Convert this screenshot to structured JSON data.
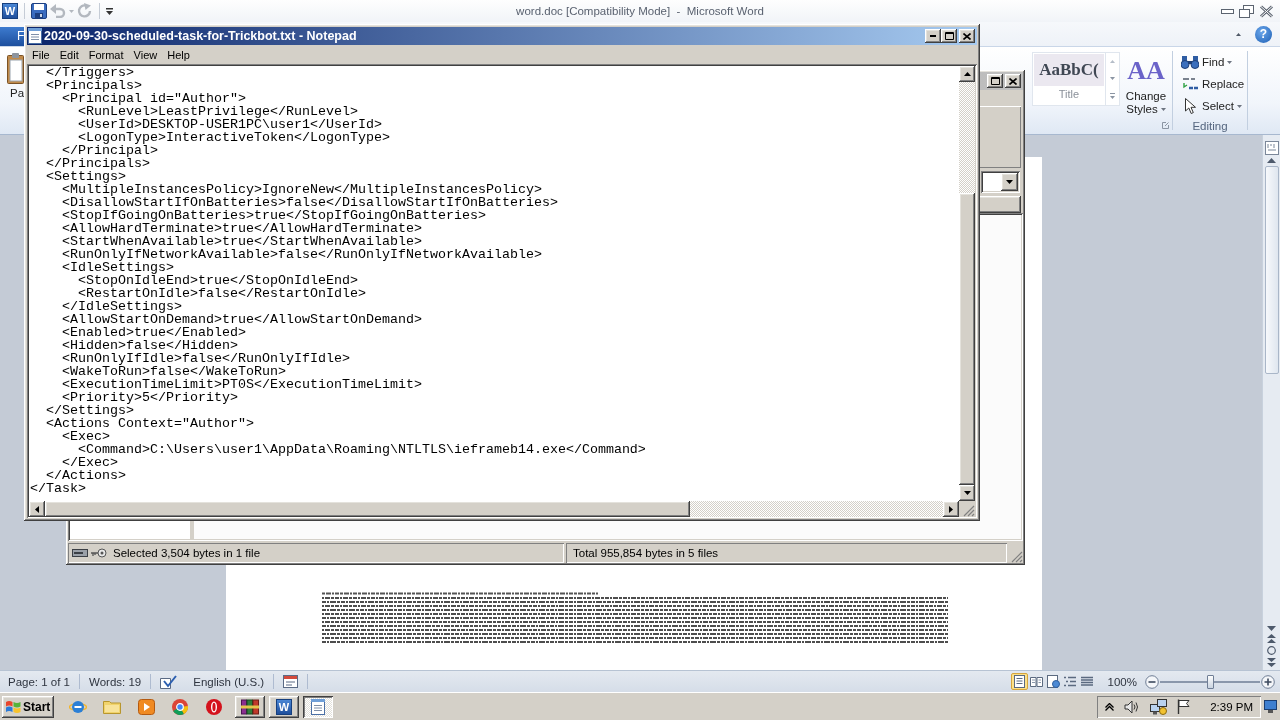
{
  "word_window": {
    "app_icon": "W",
    "quick_access": [
      {
        "kind": "save",
        "disabled": false
      },
      {
        "kind": "undo",
        "disabled": true
      },
      {
        "kind": "redo",
        "disabled": true
      }
    ],
    "title": "word.doc [Compatibility Mode]  -  Microsoft Word",
    "file_tab": "F",
    "help": "?",
    "ribbon": {
      "paste_label": "Pa",
      "style_preview": "AaBbC(",
      "style_name": "Title",
      "change_styles_icon": "AA",
      "change_styles": "Change Styles",
      "editing_items": [
        {
          "kind": "find",
          "label": "Find",
          "dropdown": true
        },
        {
          "kind": "replace",
          "label": "Replace",
          "dropdown": false
        },
        {
          "kind": "select",
          "label": "Select",
          "dropdown": true
        }
      ],
      "editing_label": "Editing"
    },
    "status_bar": {
      "page": "Page: 1 of 1",
      "words": "Words: 19",
      "language": "English (U.S.)",
      "views": [
        {
          "kind": "print-layout",
          "selected": true
        },
        {
          "kind": "full-screen-reading",
          "selected": false
        },
        {
          "kind": "web-layout",
          "selected": false
        },
        {
          "kind": "outline",
          "selected": false
        },
        {
          "kind": "draft",
          "selected": false
        }
      ],
      "zoom": "100%",
      "zoom_slider": {
        "level": 0.5
      }
    }
  },
  "explorer_window": {
    "status_bar": {
      "selection": "Selected 3,504 bytes in 1 file",
      "total": "Total 955,854 bytes in 5 files"
    }
  },
  "notepad": {
    "title": "2020-09-30-scheduled-task-for-Trickbot.txt - Notepad",
    "menu": [
      "File",
      "Edit",
      "Format",
      "View",
      "Help"
    ],
    "lines": [
      {
        "children": [
          {
            "text": "</Triggers>"
          },
          {
            "text": "<Principals>"
          },
          {
            "children": [
              {
                "text": "<Principal id=\"Author\">"
              },
              {
                "children": [
                  {
                    "text": "<RunLevel>LeastPrivilege</RunLevel>"
                  },
                  {
                    "text": "<UserId>DESKTOP-USER1PC\\user1</UserId>"
                  },
                  {
                    "text": "<LogonType>InteractiveToken</LogonType>"
                  }
                ]
              },
              {
                "text": "</Principal>"
              }
            ]
          },
          {
            "text": "</Principals>"
          },
          {
            "text": "<Settings>"
          },
          {
            "children": [
              {
                "text": "<MultipleInstancesPolicy>IgnoreNew</MultipleInstancesPolicy>"
              },
              {
                "text": "<DisallowStartIfOnBatteries>false</DisallowStartIfOnBatteries>"
              },
              {
                "text": "<StopIfGoingOnBatteries>true</StopIfGoingOnBatteries>"
              },
              {
                "text": "<AllowHardTerminate>true</AllowHardTerminate>"
              },
              {
                "text": "<StartWhenAvailable>true</StartWhenAvailable>"
              },
              {
                "text": "<RunOnlyIfNetworkAvailable>false</RunOnlyIfNetworkAvailable>"
              },
              {
                "text": "<IdleSettings>"
              },
              {
                "children": [
                  {
                    "text": "<StopOnIdleEnd>true</StopOnIdleEnd>"
                  },
                  {
                    "text": "<RestartOnIdle>false</RestartOnIdle>"
                  }
                ]
              },
              {
                "text": "</IdleSettings>"
              },
              {
                "text": "<AllowStartOnDemand>true</AllowStartOnDemand>"
              },
              {
                "text": "<Enabled>true</Enabled>"
              },
              {
                "text": "<Hidden>false</Hidden>"
              },
              {
                "text": "<RunOnlyIfIdle>false</RunOnlyIfIdle>"
              },
              {
                "text": "<WakeToRun>false</WakeToRun>"
              },
              {
                "text": "<ExecutionTimeLimit>PT0S</ExecutionTimeLimit>"
              },
              {
                "text": "<Priority>5</Priority>"
              }
            ]
          },
          {
            "text": "</Settings>"
          },
          {
            "text": "<Actions Context=\"Author\">"
          },
          {
            "children": [
              {
                "text": "<Exec>"
              },
              {
                "children": [
                  {
                    "text": "<Command>C:\\Users\\user1\\AppData\\Roaming\\NTLTLS\\ieframeb14.exe</Command>"
                  }
                ]
              },
              {
                "text": "</Exec>"
              }
            ]
          },
          {
            "text": "</Actions>"
          }
        ]
      },
      {
        "text": "</Task>"
      }
    ]
  },
  "taskbar": {
    "start": "Start",
    "quick_launch": [
      {
        "kind": "internet-explorer"
      },
      {
        "kind": "folder"
      },
      {
        "kind": "media-player"
      },
      {
        "kind": "chrome"
      },
      {
        "kind": "opera"
      }
    ],
    "tasks": [
      {
        "kind": "archive",
        "selected": false
      },
      {
        "kind": "word",
        "letter": "W",
        "selected": false
      },
      {
        "kind": "notepad",
        "selected": true
      }
    ],
    "clock": "2:39 PM"
  }
}
